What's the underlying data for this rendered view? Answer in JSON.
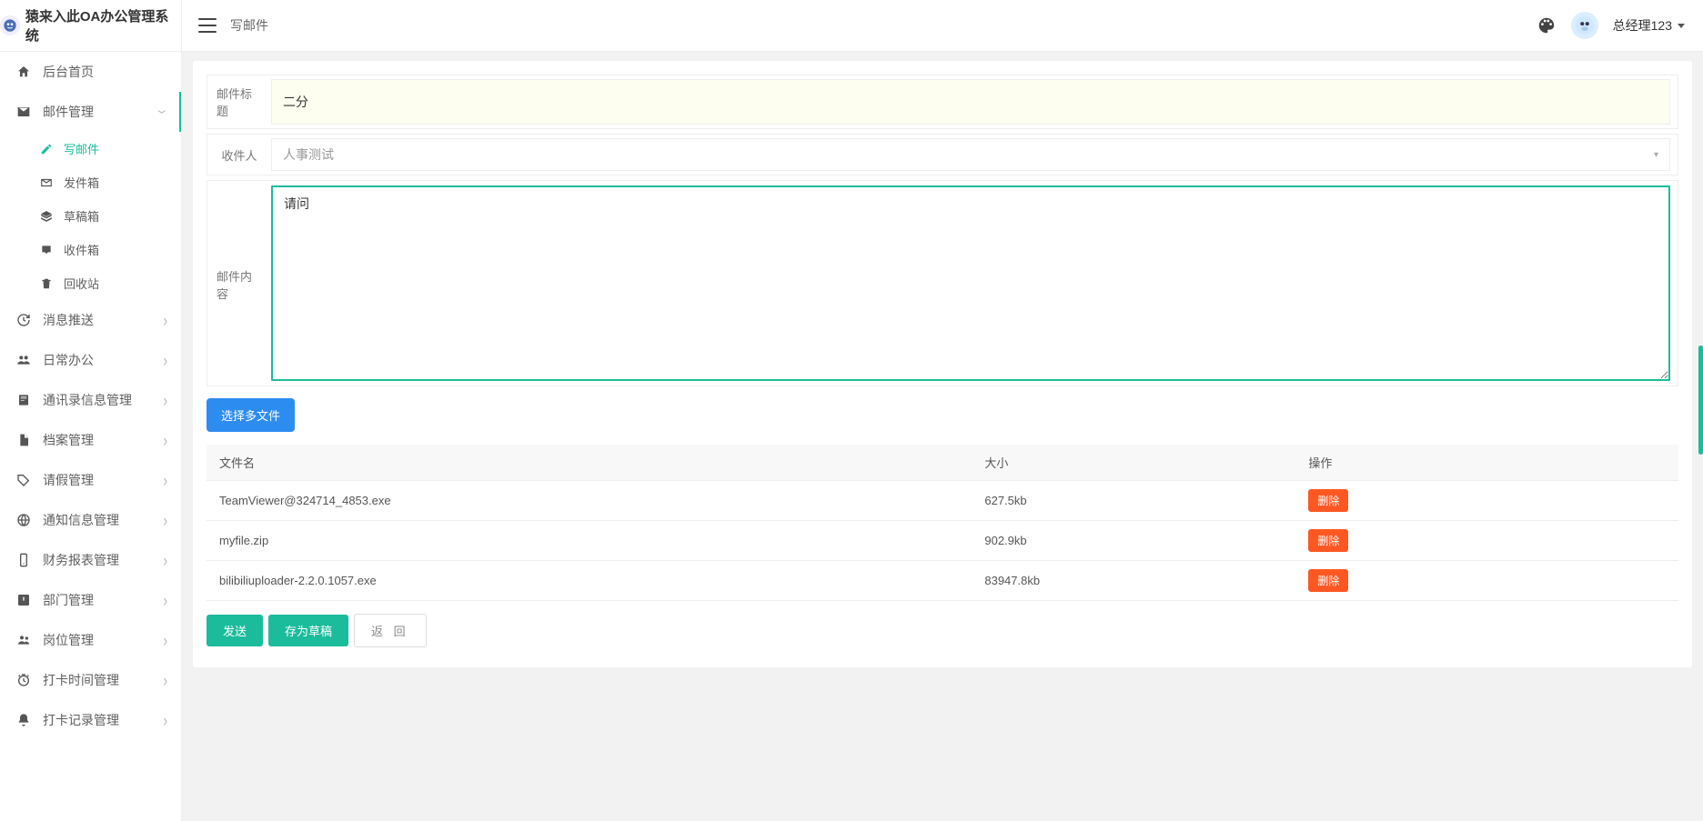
{
  "brand": {
    "title": "猿来入此OA办公管理系统"
  },
  "header": {
    "breadcrumb": "写邮件",
    "username": "总经理123"
  },
  "sidebar": {
    "items": [
      {
        "key": "home",
        "label": "后台首页",
        "icon": "home",
        "expand": false
      },
      {
        "key": "mail",
        "label": "邮件管理",
        "icon": "mail",
        "expand": true,
        "open": true,
        "active": true,
        "children": [
          {
            "key": "compose",
            "label": "写邮件",
            "icon": "edit",
            "active": true
          },
          {
            "key": "sent",
            "label": "发件箱",
            "icon": "send"
          },
          {
            "key": "draft",
            "label": "草稿箱",
            "icon": "layers"
          },
          {
            "key": "inbox",
            "label": "收件箱",
            "icon": "inbox"
          },
          {
            "key": "trash",
            "label": "回收站",
            "icon": "trash"
          }
        ]
      },
      {
        "key": "push",
        "label": "消息推送",
        "icon": "history",
        "expand": true
      },
      {
        "key": "daily",
        "label": "日常办公",
        "icon": "team",
        "expand": true
      },
      {
        "key": "contact",
        "label": "通讯录信息管理",
        "icon": "contact",
        "expand": true
      },
      {
        "key": "archive",
        "label": "档案管理",
        "icon": "archive",
        "expand": true
      },
      {
        "key": "leave",
        "label": "请假管理",
        "icon": "tag",
        "expand": true
      },
      {
        "key": "notice",
        "label": "通知信息管理",
        "icon": "globe",
        "expand": true
      },
      {
        "key": "finance",
        "label": "财务报表管理",
        "icon": "phone",
        "expand": true
      },
      {
        "key": "dept",
        "label": "部门管理",
        "icon": "warn",
        "expand": true
      },
      {
        "key": "post",
        "label": "岗位管理",
        "icon": "group",
        "expand": true
      },
      {
        "key": "clockset",
        "label": "打卡时间管理",
        "icon": "clock",
        "expand": true
      },
      {
        "key": "clocklog",
        "label": "打卡记录管理",
        "icon": "bell",
        "expand": true
      }
    ]
  },
  "form": {
    "titleLabel": "邮件标题",
    "titleValue": "二分",
    "recipientLabel": "收件人",
    "recipientPlaceholder": "人事测试",
    "contentLabel": "邮件内容",
    "contentValue": "请问",
    "uploadLabel": "选择多文件"
  },
  "fileTable": {
    "headers": {
      "name": "文件名",
      "size": "大小",
      "action": "操作"
    },
    "deleteLabel": "删除",
    "rows": [
      {
        "name": "TeamViewer@324714_4853.exe",
        "size": "627.5kb"
      },
      {
        "name": "myfile.zip",
        "size": "902.9kb"
      },
      {
        "name": "bilibiliuploader-2.2.0.1057.exe",
        "size": "83947.8kb"
      }
    ]
  },
  "actions": {
    "send": "发送",
    "saveDraft": "存为草稿",
    "back": "返 回"
  }
}
